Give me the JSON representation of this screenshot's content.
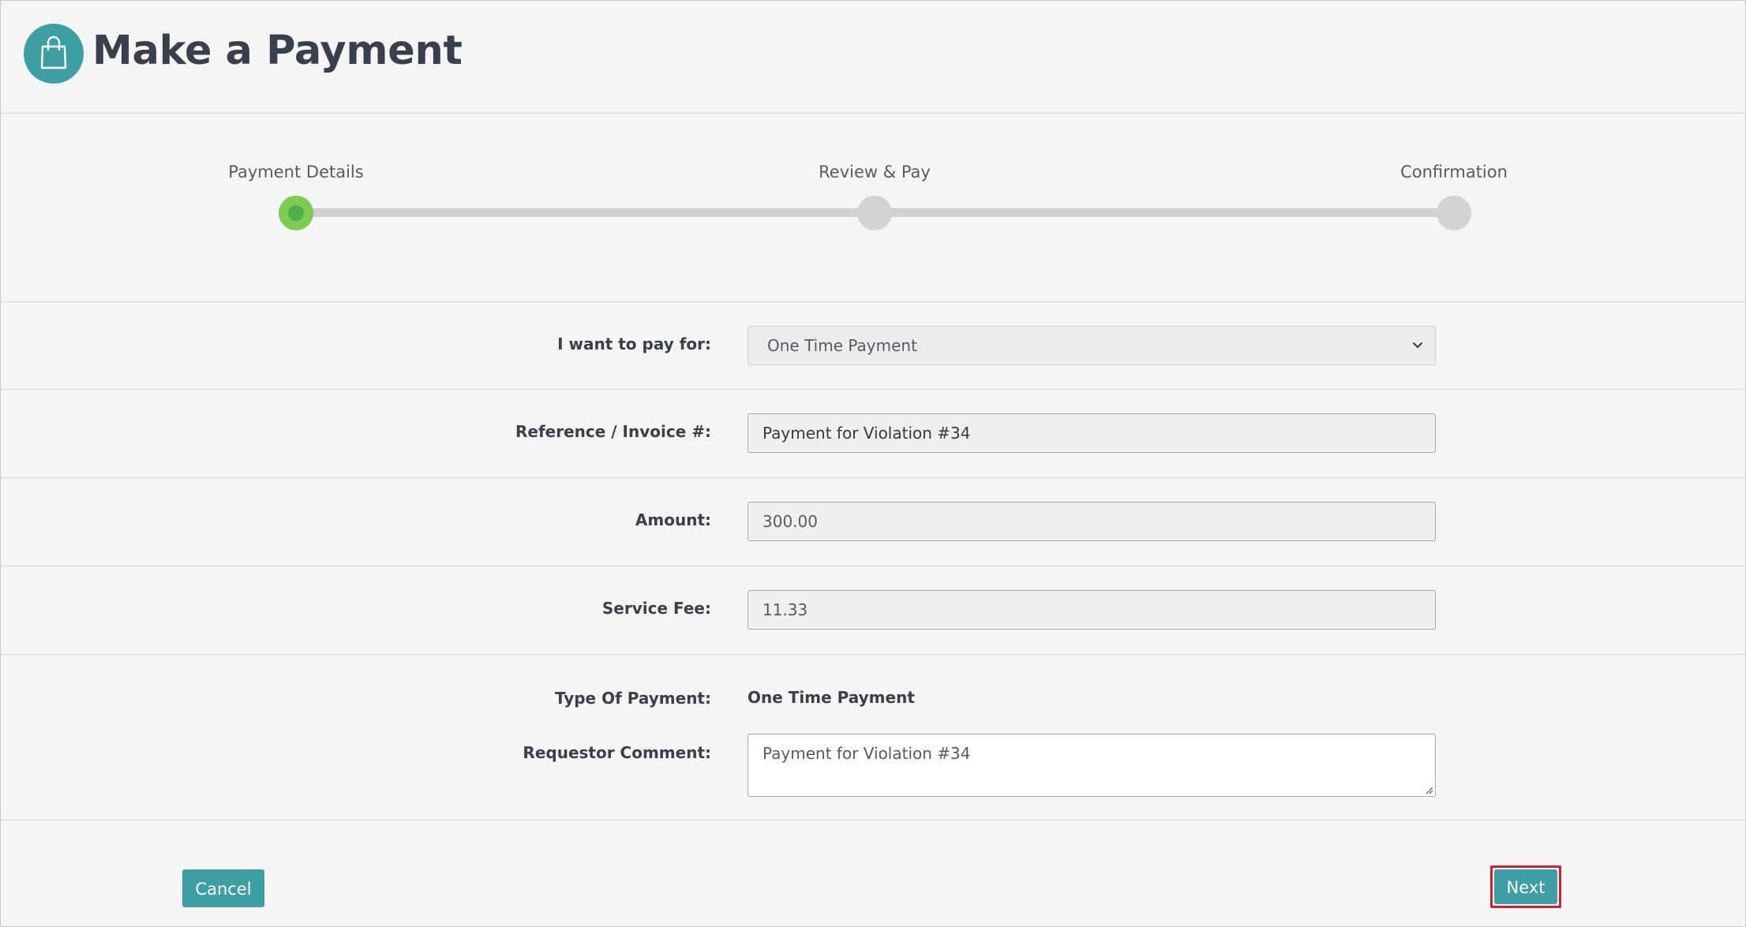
{
  "page": {
    "title": "Make a Payment",
    "logo_icon": "shopping-bag-icon",
    "accent_color": "#3d9ea3"
  },
  "stepper": {
    "steps": [
      {
        "label": "Payment Details",
        "state": "active"
      },
      {
        "label": "Review & Pay",
        "state": "pending"
      },
      {
        "label": "Confirmation",
        "state": "pending"
      }
    ],
    "active_color": "#7ccc54"
  },
  "form": {
    "pay_for": {
      "label": "I want to pay for:",
      "selected": "One Time Payment"
    },
    "reference": {
      "label": "Reference / Invoice #:",
      "value": "Payment for Violation #34"
    },
    "amount": {
      "label": "Amount:",
      "value": "300.00"
    },
    "service_fee": {
      "label": "Service Fee:",
      "value": "11.33"
    },
    "payment_type": {
      "label": "Type Of Payment:",
      "value": "One Time Payment"
    },
    "comment": {
      "label": "Requestor Comment:",
      "value": "Payment for Violation #34"
    }
  },
  "footer": {
    "cancel_label": "Cancel",
    "next_label": "Next",
    "highlight_color": "#d0202f"
  }
}
